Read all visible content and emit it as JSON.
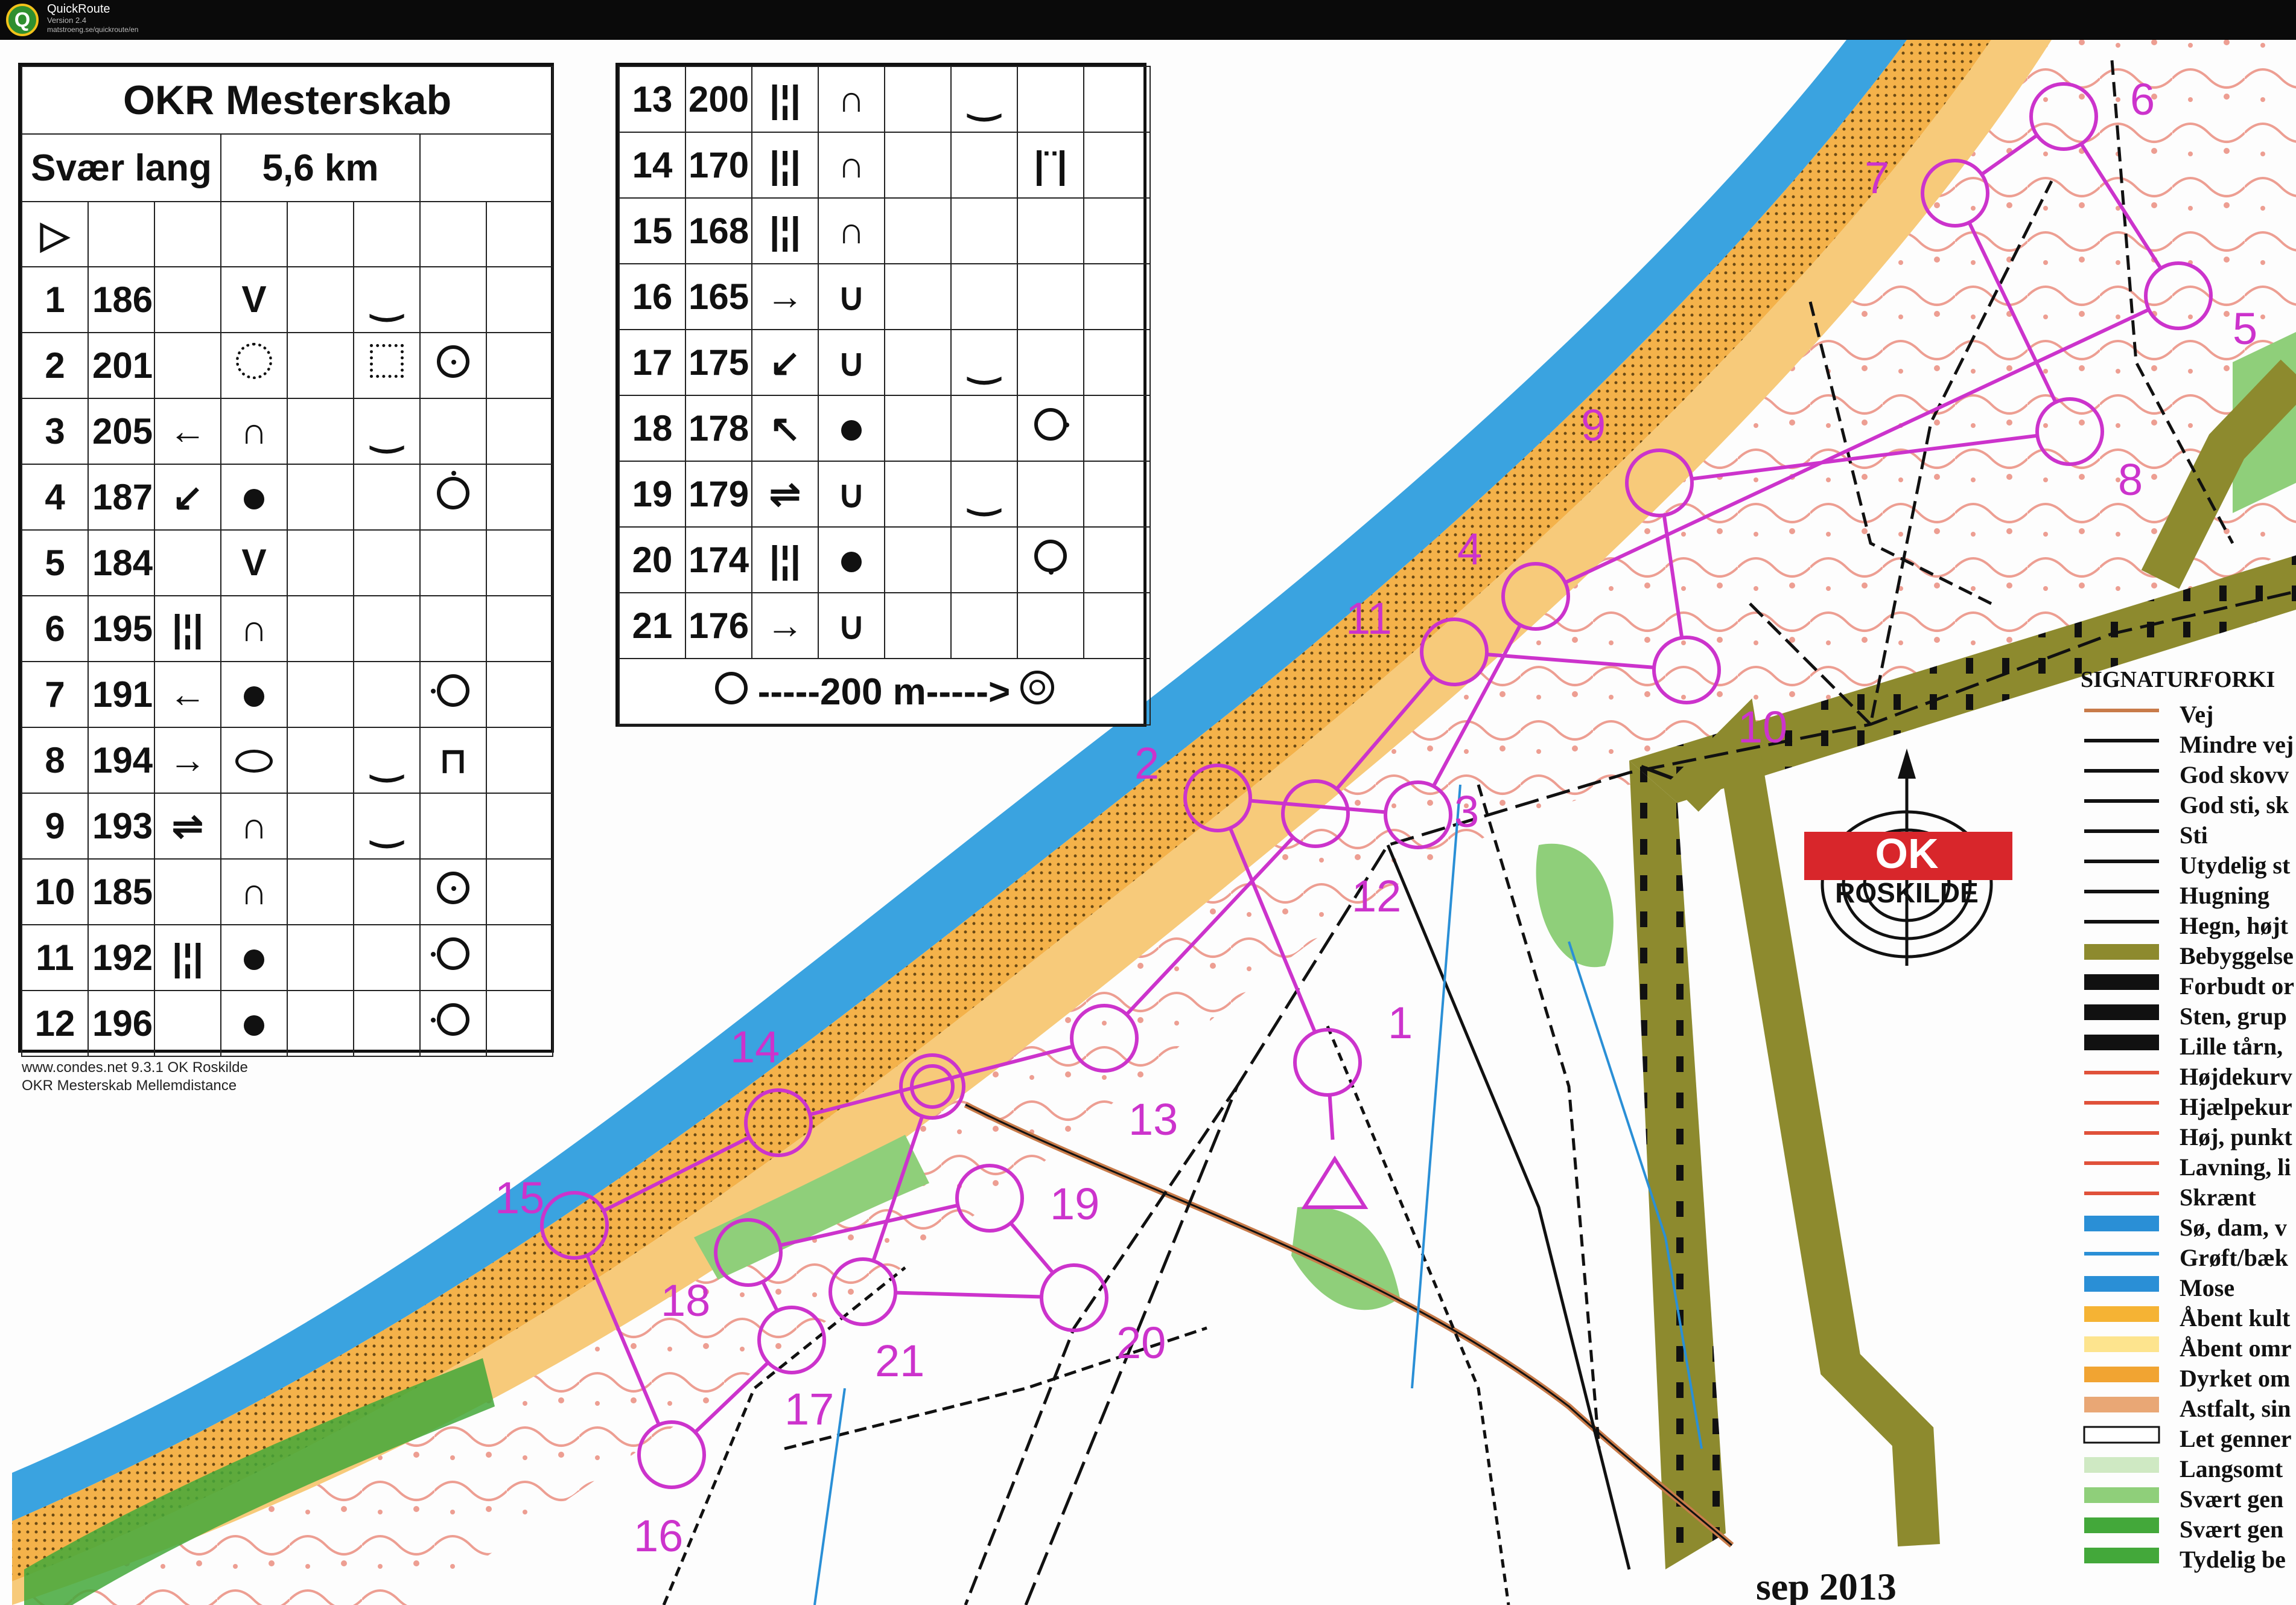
{
  "app": {
    "name": "QuickRoute",
    "version": "Version 2.4",
    "url": "matstroeng.se/quickroute/en"
  },
  "control_card_left": {
    "title": "OKR Mesterskab",
    "class_name": "Svær lang",
    "distance": "5,6 km",
    "start_symbol": "▷",
    "rows": [
      {
        "num": "1",
        "code": "186",
        "dir": "",
        "feature": "V",
        "appearance": "‿",
        "other": ""
      },
      {
        "num": "2",
        "code": "201",
        "dir": "",
        "feature": "dotted-circle",
        "appearance": "dotted-square",
        "other": "circle-dot"
      },
      {
        "num": "3",
        "code": "205",
        "dir": "←",
        "feature": "∩",
        "appearance": "‿",
        "other": ""
      },
      {
        "num": "4",
        "code": "187",
        "dir": "↙",
        "feature": "dot",
        "appearance": "",
        "other": "circle-top"
      },
      {
        "num": "5",
        "code": "184",
        "dir": "",
        "feature": "V",
        "appearance": "",
        "other": ""
      },
      {
        "num": "6",
        "code": "195",
        "dir": "|¦|",
        "feature": "∩",
        "appearance": "",
        "other": ""
      },
      {
        "num": "7",
        "code": "191",
        "dir": "←",
        "feature": "dot",
        "appearance": "",
        "other": "circle-left"
      },
      {
        "num": "8",
        "code": "194",
        "dir": "→",
        "feature": "ellipse",
        "appearance": "‿",
        "other": "gate"
      },
      {
        "num": "9",
        "code": "193",
        "dir": "⇌",
        "feature": "∩",
        "appearance": "‿",
        "other": ""
      },
      {
        "num": "10",
        "code": "185",
        "dir": "",
        "feature": "∩",
        "appearance": "",
        "other": "circle-dot"
      },
      {
        "num": "11",
        "code": "192",
        "dir": "|¦|",
        "feature": "dot",
        "appearance": "",
        "other": "circle-left"
      },
      {
        "num": "12",
        "code": "196",
        "dir": "",
        "feature": "dot",
        "appearance": "",
        "other": "circle-left"
      }
    ],
    "footer_line1": "www.condes.net 9.3.1 OK Roskilde",
    "footer_line2": "OKR Mesterskab Mellemdistance"
  },
  "control_card_right": {
    "rows": [
      {
        "num": "13",
        "code": "200",
        "dir": "|¦|",
        "feature": "∩",
        "appearance": "‿",
        "other": ""
      },
      {
        "num": "14",
        "code": "170",
        "dir": "|¦|",
        "feature": "∩",
        "appearance": "",
        "other": "|¨|"
      },
      {
        "num": "15",
        "code": "168",
        "dir": "|¦|",
        "feature": "∩",
        "appearance": "",
        "other": ""
      },
      {
        "num": "16",
        "code": "165",
        "dir": "→",
        "feature": "∪",
        "appearance": "",
        "other": ""
      },
      {
        "num": "17",
        "code": "175",
        "dir": "↙",
        "feature": "∪",
        "appearance": "‿",
        "other": ""
      },
      {
        "num": "18",
        "code": "178",
        "dir": "↖",
        "feature": "dot",
        "appearance": "",
        "other": "circle-right"
      },
      {
        "num": "19",
        "code": "179",
        "dir": "⇌",
        "feature": "∪",
        "appearance": "‿",
        "other": ""
      },
      {
        "num": "20",
        "code": "174",
        "dir": "|¦|",
        "feature": "dot",
        "appearance": "",
        "other": "circle-bottom"
      },
      {
        "num": "21",
        "code": "176",
        "dir": "→",
        "feature": "∪",
        "appearance": "",
        "other": ""
      }
    ],
    "finish_text": "-----200 m----->"
  },
  "legend": {
    "title": "SIGNATURFORKI",
    "items": [
      {
        "label": "Vej",
        "color": "#c87b4a"
      },
      {
        "label": "Mindre vej",
        "color": "#111111"
      },
      {
        "label": "God skovv",
        "color": "#111111"
      },
      {
        "label": "God sti, sk",
        "color": "#111111"
      },
      {
        "label": "Sti",
        "color": "#111111"
      },
      {
        "label": "Utydelig st",
        "color": "#111111"
      },
      {
        "label": "Hugning",
        "color": "#111111"
      },
      {
        "label": "Hegn, højt",
        "color": "#111111"
      },
      {
        "label": "Bebyggelse",
        "color": "#8d8a2e"
      },
      {
        "label": "Forbudt or",
        "color": "#111111"
      },
      {
        "label": "Sten, grup",
        "color": "#111111"
      },
      {
        "label": "Lille tårn,",
        "color": "#111111"
      },
      {
        "label": "Højdekurv",
        "color": "#e0513a"
      },
      {
        "label": "Hjælpekur",
        "color": "#e0513a"
      },
      {
        "label": "Høj, punkt",
        "color": "#e0513a"
      },
      {
        "label": "Lavning, li",
        "color": "#e0513a"
      },
      {
        "label": "Skrænt",
        "color": "#e0513a"
      },
      {
        "label": "Sø, dam, v",
        "color": "#2a8fd6"
      },
      {
        "label": "Grøft/bæk",
        "color": "#2a8fd6"
      },
      {
        "label": "Mose",
        "color": "#2a8fd6"
      },
      {
        "label": "Åbent kult",
        "color": "#f5b334"
      },
      {
        "label": "Åbent omr",
        "color": "#fde48e"
      },
      {
        "label": "Dyrket om",
        "color": "#f1a432"
      },
      {
        "label": "Astfalt, sin",
        "color": "#e9a775"
      },
      {
        "label": "Let genner",
        "color": "#ffffff"
      },
      {
        "label": "Langsomt",
        "color": "#cfe9c3"
      },
      {
        "label": "Svært gen",
        "color": "#8fcf7a"
      },
      {
        "label": "Svært gen",
        "color": "#43a83a"
      },
      {
        "label": "Tydelig be",
        "color": "#43a83a"
      }
    ]
  },
  "club_logo": {
    "letters": "OK",
    "name": "ROSKILDE"
  },
  "map_date": "sep 2013",
  "controls": {
    "start_label": "",
    "labels": [
      "1",
      "2",
      "3",
      "4",
      "5",
      "6",
      "7",
      "8",
      "9",
      "10",
      "11",
      "12",
      "13",
      "14",
      "15",
      "16",
      "17",
      "18",
      "19",
      "20",
      "21"
    ]
  },
  "colors": {
    "course": "#cc33cc",
    "water": "#3aa3e0",
    "sand": "#f4b24a",
    "contour": "#e0513a",
    "forest": "#43a83a",
    "settlement": "#8d8a2e"
  }
}
